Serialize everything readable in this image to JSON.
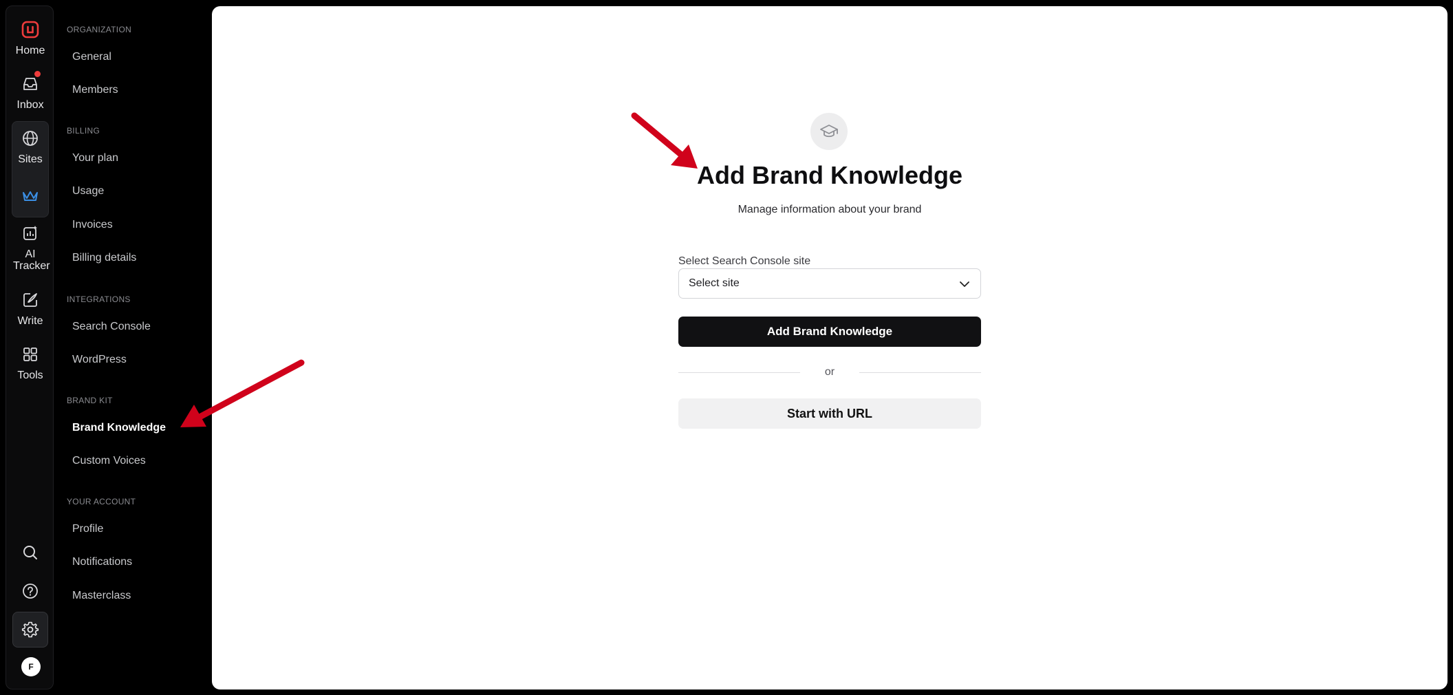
{
  "rail": {
    "items": [
      {
        "label": "Home",
        "icon": "home-logo-icon"
      },
      {
        "label": "Inbox",
        "icon": "inbox-icon"
      },
      {
        "label": "Sites",
        "icon": "globe-icon"
      },
      {
        "label": "AI Tracker",
        "icon": "ai-tracker-icon"
      },
      {
        "label": "Write",
        "icon": "write-icon"
      },
      {
        "label": "Tools",
        "icon": "grid-icon"
      }
    ],
    "avatar_initial": "F",
    "accent_color": "#ef3c3c",
    "crown_color": "#3b8fe5"
  },
  "nav": {
    "sections": [
      {
        "title": "ORGANIZATION",
        "items": [
          "General",
          "Members"
        ]
      },
      {
        "title": "BILLING",
        "items": [
          "Your plan",
          "Usage",
          "Invoices",
          "Billing details"
        ]
      },
      {
        "title": "INTEGRATIONS",
        "items": [
          "Search Console",
          "WordPress"
        ]
      },
      {
        "title": "BRAND KIT",
        "items": [
          "Brand Knowledge",
          "Custom Voices"
        ]
      },
      {
        "title": "YOUR ACCOUNT",
        "items": [
          "Profile",
          "Notifications",
          "Masterclass"
        ]
      }
    ],
    "active_item": "Brand Knowledge"
  },
  "main": {
    "title": "Add Brand Knowledge",
    "subtitle": "Manage information about your brand",
    "select_label": "Select Search Console site",
    "select_value": "Select site",
    "primary_button": "Add Brand Knowledge",
    "divider_text": "or",
    "secondary_button": "Start with URL"
  },
  "annotation_color": "#d0021b"
}
